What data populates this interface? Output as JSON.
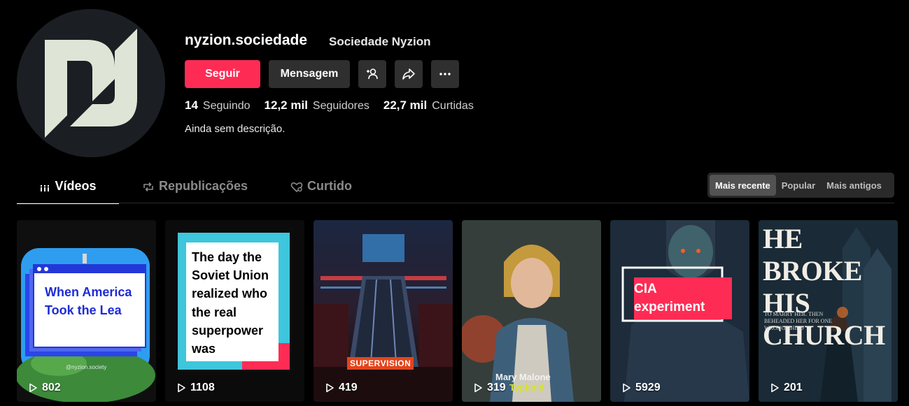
{
  "profile": {
    "username": "nyzion.sociedade",
    "nickname": "Sociedade Nyzion",
    "bio": "Ainda sem descrição."
  },
  "buttons": {
    "follow": "Seguir",
    "message": "Mensagem",
    "add_user_icon": "add-user-icon",
    "share_icon": "share-icon",
    "more_icon": "more-icon"
  },
  "stats": [
    {
      "value": "14",
      "label": "Seguindo"
    },
    {
      "value": "12,2 mil",
      "label": "Seguidores"
    },
    {
      "value": "22,7 mil",
      "label": "Curtidas"
    }
  ],
  "tabs": [
    {
      "label": "Vídeos",
      "icon": "grid-icon",
      "active": true
    },
    {
      "label": "Republicações",
      "icon": "repost-icon",
      "active": false
    },
    {
      "label": "Curtido",
      "icon": "heart-icon",
      "active": false
    }
  ],
  "sort": {
    "options": [
      "Mais recente",
      "Popular",
      "Mais antigos"
    ],
    "selected": "Mais recente"
  },
  "videos": [
    {
      "views": "802",
      "text": "When America Took the Lea",
      "watermark": "@nyzion.society"
    },
    {
      "views": "1108",
      "text": "The day the Soviet Union realized who the real superpower was"
    },
    {
      "views": "419",
      "text": "SUPERVISION"
    },
    {
      "views": "319",
      "text": "Mary Malone",
      "text2": "Typhoid"
    },
    {
      "views": "5929",
      "text": "CIA experiment"
    },
    {
      "views": "201",
      "text": "HE BROKE HIS CHURCH",
      "text2": "TO MARRY HER. THEN BEHEADED HER FOR ONE WRONG CHILD"
    }
  ],
  "colors": {
    "accent": "#fe2c55",
    "background": "#000000",
    "button": "#2f2f2f"
  }
}
